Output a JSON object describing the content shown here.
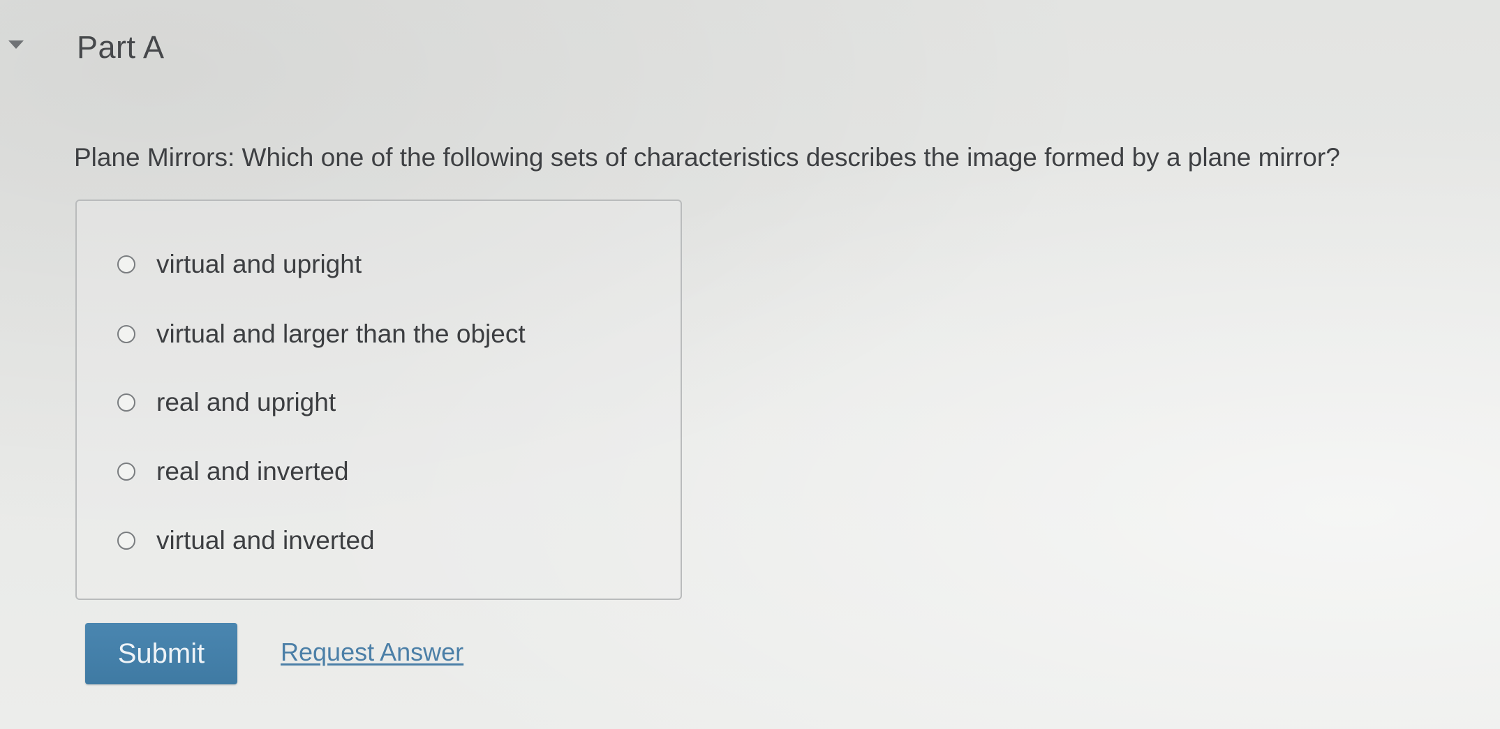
{
  "part": {
    "title": "Part A"
  },
  "question": {
    "text": "Plane Mirrors: Which one of the following sets of characteristics describes the image formed by a plane mirror?"
  },
  "options": [
    {
      "label": "virtual and upright"
    },
    {
      "label": "virtual and larger than the object"
    },
    {
      "label": "real and upright"
    },
    {
      "label": "real and inverted"
    },
    {
      "label": "virtual and inverted"
    }
  ],
  "actions": {
    "submit_label": "Submit",
    "request_answer_label": "Request Answer"
  },
  "colors": {
    "submit_bg": "#4580ab",
    "link": "#4b7fa7"
  },
  "icons": {
    "collapse": "caret-down-icon",
    "radio": "radio-unchecked-icon"
  }
}
